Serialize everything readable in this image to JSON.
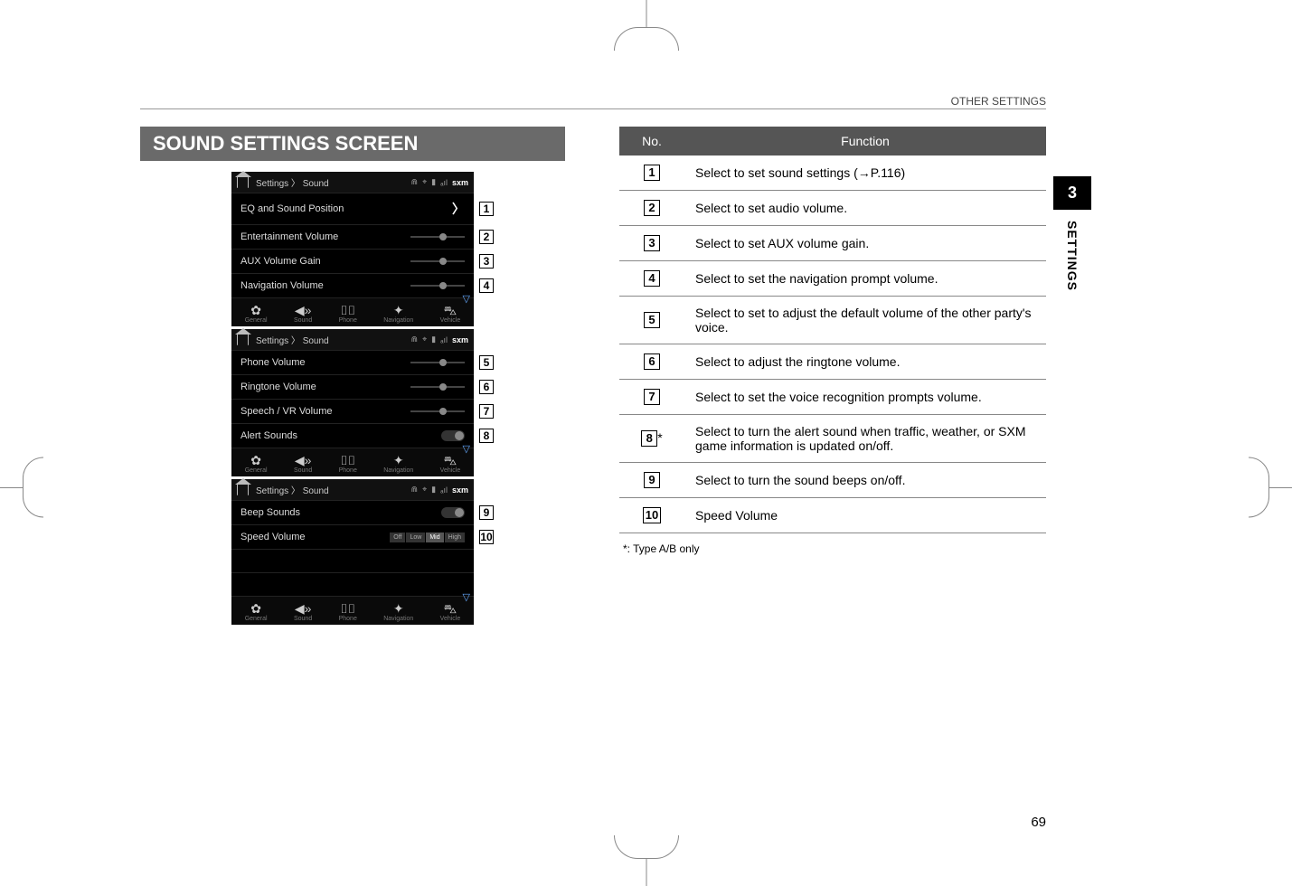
{
  "header": {
    "category": "OTHER SETTINGS"
  },
  "section_title": "SOUND SETTINGS SCREEN",
  "side_tab": {
    "chapter": "3",
    "label": "SETTINGS"
  },
  "page_number": "69",
  "shots": {
    "breadcrumb": "Settings  〉 Sound",
    "status_sxm": "sxm",
    "footer": [
      {
        "glyph": "⚙",
        "label": "General"
      },
      {
        "glyph": "🔊",
        "label": "Sound"
      },
      {
        "glyph": "☎",
        "label": "Phone"
      },
      {
        "glyph": "🧭",
        "label": "Navigation"
      },
      {
        "glyph": "🚗",
        "label": "Vehicle"
      }
    ],
    "shot1": [
      {
        "label": "EQ and Sound Position",
        "ctrl": "chevron",
        "callout": "1"
      },
      {
        "label": "Entertainment Volume",
        "ctrl": "slider",
        "callout": "2"
      },
      {
        "label": "AUX Volume Gain",
        "ctrl": "slider",
        "callout": "3"
      },
      {
        "label": "Navigation Volume",
        "ctrl": "slider",
        "callout": "4"
      }
    ],
    "shot2": [
      {
        "label": "Phone Volume",
        "ctrl": "slider",
        "callout": "5"
      },
      {
        "label": "Ringtone Volume",
        "ctrl": "slider",
        "callout": "6"
      },
      {
        "label": "Speech / VR Volume",
        "ctrl": "slider",
        "callout": "7"
      },
      {
        "label": "Alert Sounds",
        "ctrl": "toggle",
        "callout": "8"
      }
    ],
    "shot3": [
      {
        "label": "Beep Sounds",
        "ctrl": "toggle",
        "callout": "9"
      },
      {
        "label": "Speed Volume",
        "ctrl": "seg",
        "callout": "10"
      }
    ],
    "seg_options": [
      "Off",
      "Low",
      "Mid",
      "High"
    ]
  },
  "table": {
    "headers": {
      "no": "No.",
      "func": "Function"
    },
    "rows": [
      {
        "no": "1",
        "star": "",
        "func": "Select to set sound settings (→P.116)"
      },
      {
        "no": "2",
        "star": "",
        "func": "Select to set audio volume."
      },
      {
        "no": "3",
        "star": "",
        "func": "Select to set AUX volume gain."
      },
      {
        "no": "4",
        "star": "",
        "func": "Select to set the navigation prompt volume."
      },
      {
        "no": "5",
        "star": "",
        "func": "Select to set to adjust the default volume of the other party's voice."
      },
      {
        "no": "6",
        "star": "",
        "func": "Select to adjust the ringtone volume."
      },
      {
        "no": "7",
        "star": "",
        "func": "Select to set the voice recognition prompts volume."
      },
      {
        "no": "8",
        "star": "*",
        "func": "Select to turn the alert sound when traffic, weather, or SXM game information is updated on/off."
      },
      {
        "no": "9",
        "star": "",
        "func": "Select to turn the sound beeps on/off."
      },
      {
        "no": "10",
        "star": "",
        "func": "Speed Volume"
      }
    ]
  },
  "footnote": "*:   Type A/B only"
}
